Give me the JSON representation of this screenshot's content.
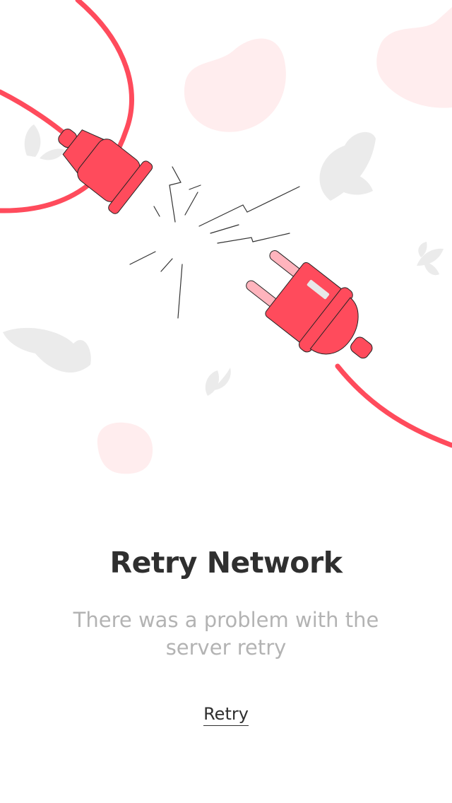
{
  "error": {
    "title": "Retry Network",
    "message": "There was a problem with the server retry",
    "retry_label": "Retry"
  },
  "colors": {
    "accent": "#FF4B5C",
    "accent_light": "#FFEDEE",
    "leaf": "#EBEBEB",
    "title": "#2F2F2F",
    "message": "#B3B3B3"
  },
  "icons": [
    "unplugged-cable-illustration",
    "plug-icon",
    "socket-icon",
    "spark-icon",
    "leaf-icon",
    "blob-shape"
  ]
}
